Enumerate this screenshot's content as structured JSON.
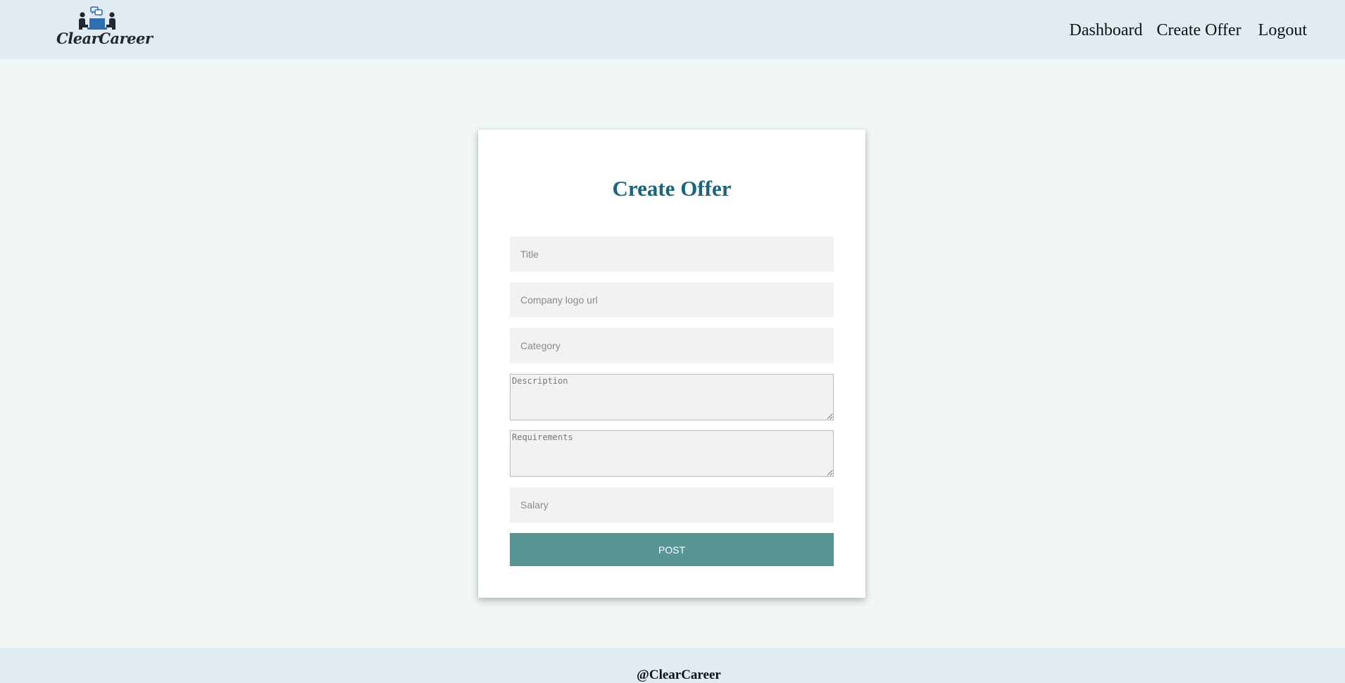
{
  "brand": {
    "name": "ClearCareer",
    "logo_icon": "people-meeting-icon",
    "color": "#2f6db5"
  },
  "nav": {
    "dashboard": "Dashboard",
    "create_offer": "Create Offer",
    "logout": "Logout"
  },
  "form": {
    "title": "Create Offer",
    "title_placeholder": "Title",
    "logo_placeholder": "Company logo url",
    "category_placeholder": "Category",
    "description_placeholder": "Description",
    "requirements_placeholder": "Requirements",
    "salary_placeholder": "Salary",
    "submit_label": "POST",
    "accent_color": "#1b6479",
    "button_color": "#5a9595"
  },
  "footer": {
    "text": "@ClearCareer"
  }
}
